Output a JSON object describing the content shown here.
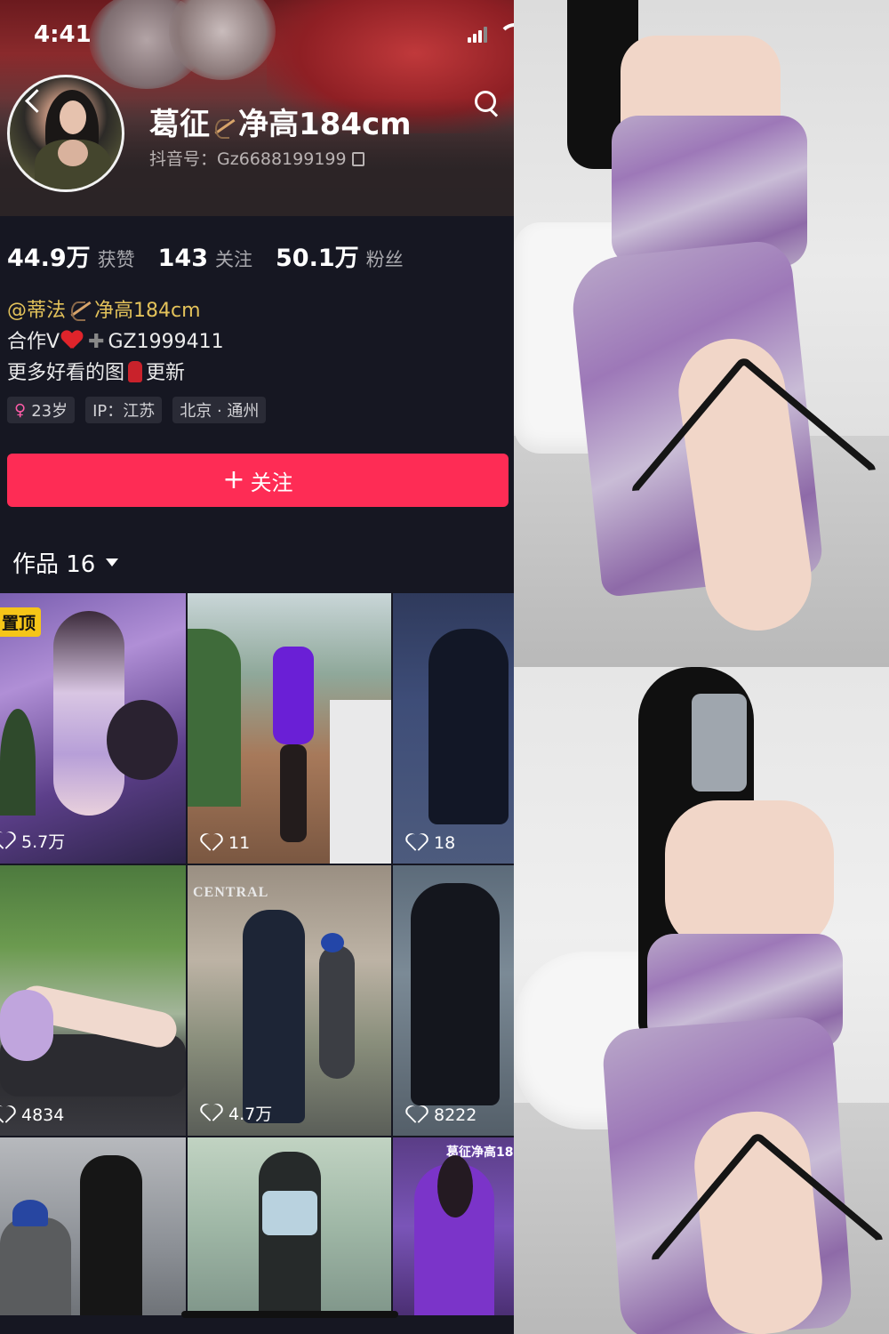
{
  "status_bar": {
    "time": "4:41"
  },
  "profile": {
    "nickname": "葛征🏹净高184cm",
    "nickname_text_a": "葛征",
    "nickname_text_b": "净高184cm",
    "douyin_id": "抖音号：Gz6688199199"
  },
  "stats": [
    {
      "value": "44.9万",
      "label": "获赞"
    },
    {
      "value": "143",
      "label": "关注"
    },
    {
      "value": "50.1万",
      "label": "粉丝"
    }
  ],
  "bio": {
    "line1_a": "@蒂法",
    "line1_b": "净高184cm",
    "line2_a": "合作V",
    "line2_b": "GZ1999411",
    "line3_a": "更多好看的图",
    "line3_b": "更新"
  },
  "tags": [
    {
      "icon": "female-icon",
      "text": "23岁"
    },
    {
      "text": "IP：江苏"
    },
    {
      "text": "北京 · 通州"
    }
  ],
  "follow_button": {
    "label": "关注"
  },
  "works_tab": {
    "label": "作品 16"
  },
  "grid": [
    {
      "likes": "5.7万",
      "badge": "置顶"
    },
    {
      "likes": "11"
    },
    {
      "likes": "18"
    },
    {
      "likes": "4834"
    },
    {
      "likes": "4.7万",
      "sign_text": "CENTRAL"
    },
    {
      "likes": "8222"
    },
    {
      "likes": ""
    },
    {
      "likes": ""
    },
    {
      "likes": "",
      "watermark": "葛征净高18"
    }
  ],
  "colors": {
    "background": "#161722",
    "follow_button": "#fe2c55",
    "mention": "#e3c25a",
    "pin_badge": "#f5c518"
  }
}
